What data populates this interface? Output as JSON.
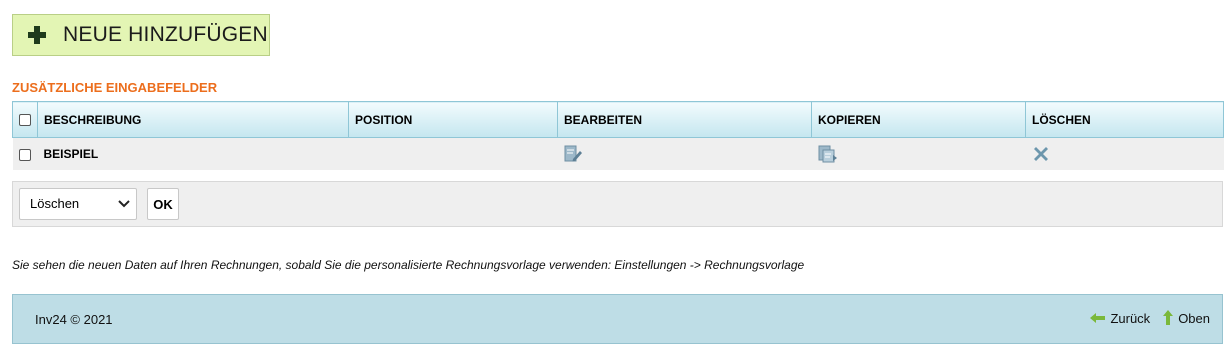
{
  "add_button": {
    "label": "NEUE HINZUFÜGEN",
    "icon": "plus-icon"
  },
  "section": {
    "title": "ZUSÄTZLICHE EINGABEFELDER"
  },
  "table": {
    "headers": {
      "description": "BESCHREIBUNG",
      "position": "POSITION",
      "edit": "BEARBEITEN",
      "copy": "KOPIEREN",
      "delete": "LÖSCHEN"
    },
    "rows": [
      {
        "description": "BEISPIEL",
        "position": ""
      }
    ]
  },
  "bulk_action": {
    "selected": "Löschen",
    "ok_label": "OK"
  },
  "info": {
    "text": "Sie sehen die neuen Daten auf Ihren Rechnungen, sobald Sie die personalisierte Rechnungsvorlage verwenden: Einstellungen -> Rechnungsvorlage"
  },
  "footer": {
    "copyright": "Inv24 © 2021",
    "back_label": "Zurück",
    "top_label": "Oben"
  },
  "colors": {
    "add_button_bg": "#e3f5b4",
    "section_title": "#ec6e1d",
    "header_bg": "#c4e6ef",
    "footer_bg": "#bedde6",
    "icon_blue": "#7a9fb5",
    "arrow_green": "#7ab83a"
  }
}
